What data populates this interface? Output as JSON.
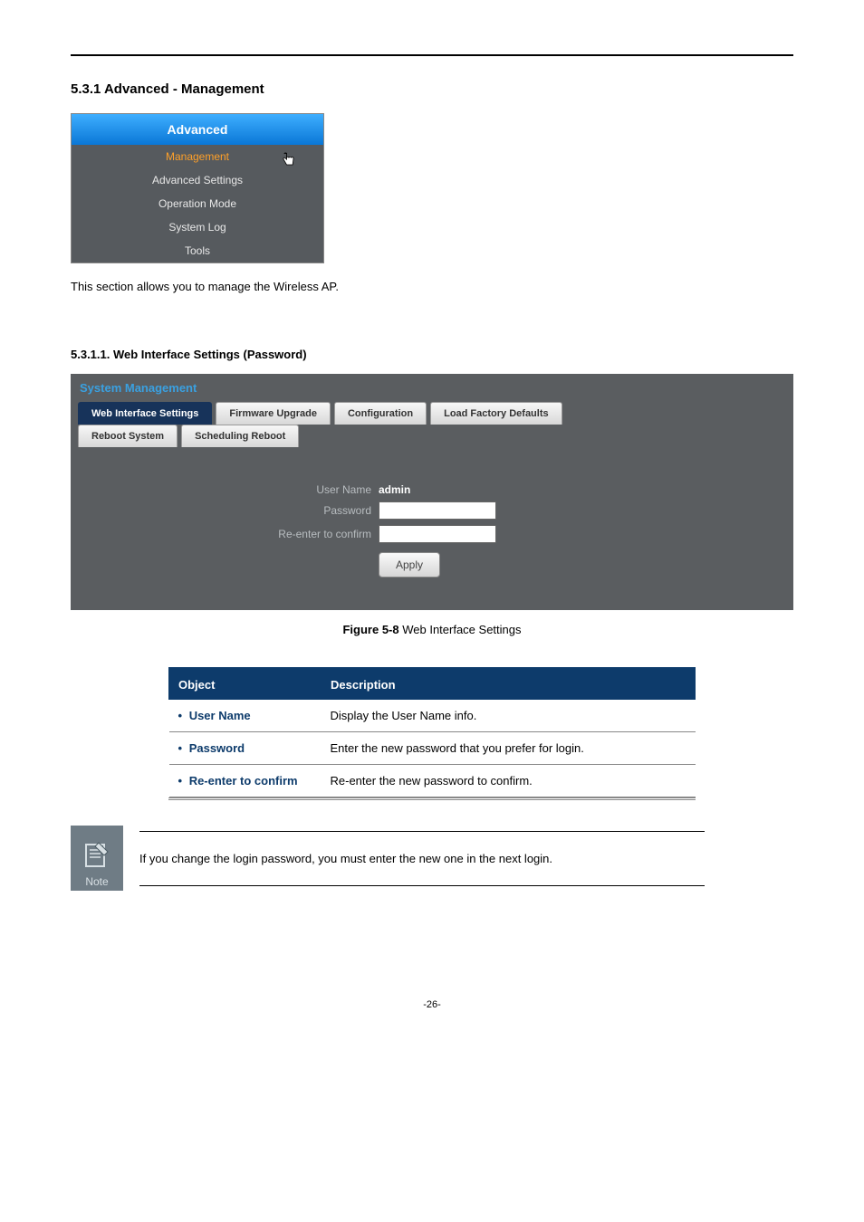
{
  "heading_section": "5.3.1  Advanced - Management",
  "adv_menu": {
    "header": "Advanced",
    "items": [
      "Management",
      "Advanced Settings",
      "Operation Mode",
      "System Log",
      "Tools"
    ],
    "active_index": 0
  },
  "body_text": "This section allows you to manage the Wireless AP.",
  "sub_heading": "5.3.1.1.  Web Interface Settings (Password)",
  "sys_panel": {
    "title": "System Management",
    "tabs_row1": [
      "Web Interface Settings",
      "Firmware Upgrade",
      "Configuration",
      "Load Factory Defaults"
    ],
    "tabs_row2": [
      "Reboot System",
      "Scheduling Reboot"
    ],
    "active_tab": "Web Interface Settings",
    "form": {
      "user_name_label": "User Name",
      "user_name_value": "admin",
      "password_label": "Password",
      "confirm_label": "Re-enter to confirm",
      "apply_button": "Apply"
    }
  },
  "figure": {
    "bold": "Figure 5-8",
    "text": " Web Interface Settings"
  },
  "obj_table": {
    "headers": [
      "Object",
      "Description"
    ],
    "rows": [
      {
        "obj": "User Name",
        "desc": "Display the User Name info."
      },
      {
        "obj": "Password",
        "desc": "Enter the new password that you prefer for login."
      },
      {
        "obj": "Re-enter to confirm",
        "desc": "Re-enter the new password to confirm."
      }
    ]
  },
  "note": {
    "label": "Note",
    "text": "If you change the login password, you must enter the new one in the next login."
  },
  "page_number": "-26-"
}
